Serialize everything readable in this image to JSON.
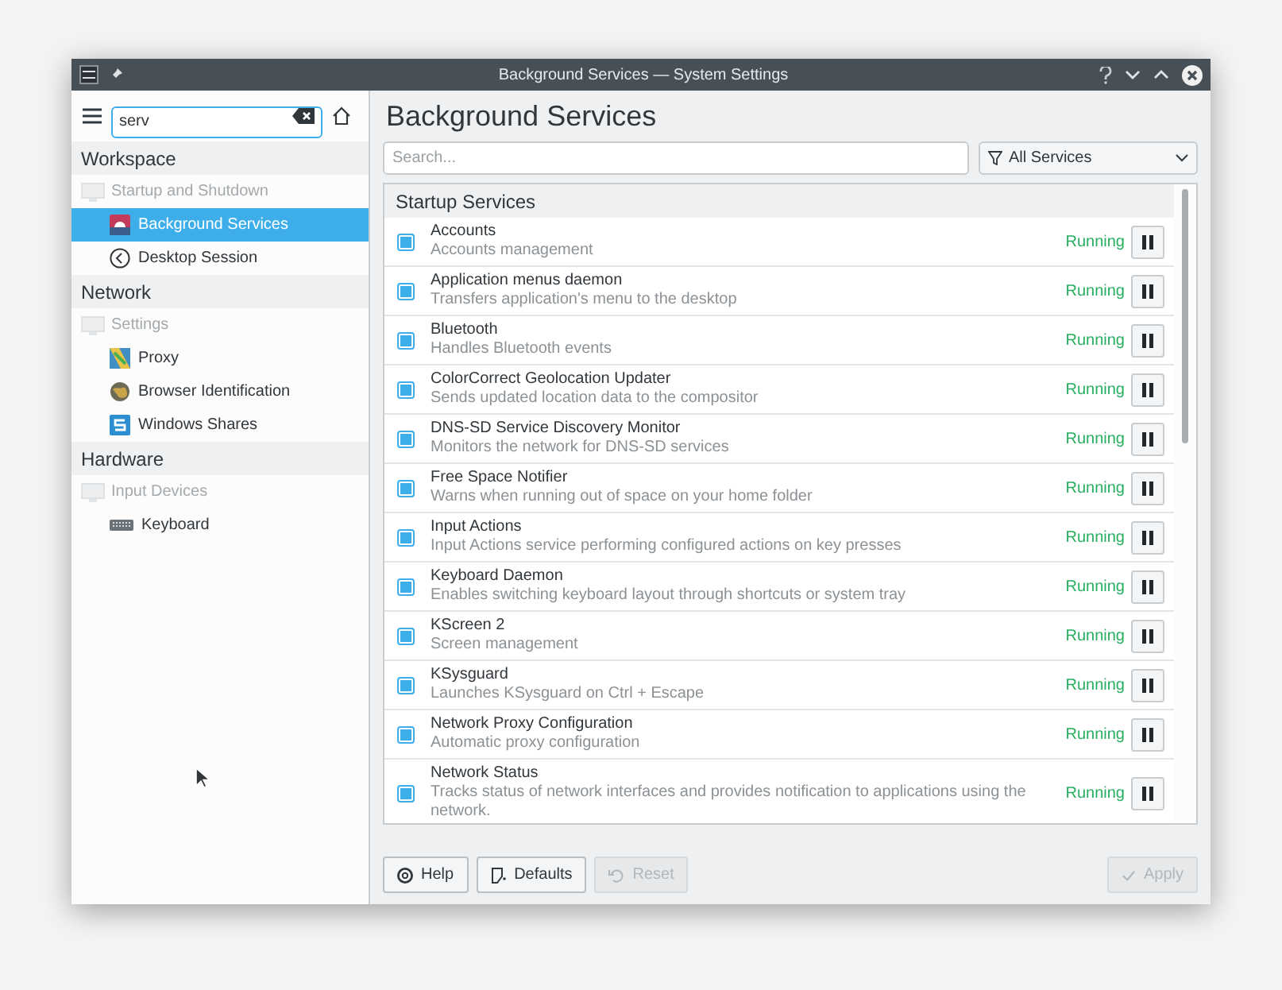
{
  "window": {
    "title": "Background Services — System Settings"
  },
  "sidebar": {
    "search": {
      "value": "serv"
    },
    "groups": [
      {
        "title": "Workspace",
        "items": [
          {
            "label": "Startup and Shutdown",
            "disabled": true,
            "children": [
              {
                "label": "Background Services",
                "selected": true
              },
              {
                "label": "Desktop Session",
                "selected": false
              }
            ]
          }
        ]
      },
      {
        "title": "Network",
        "items": [
          {
            "label": "Settings",
            "disabled": true,
            "children": [
              {
                "label": "Proxy",
                "selected": false
              },
              {
                "label": "Browser Identification",
                "selected": false
              },
              {
                "label": "Windows Shares",
                "selected": false
              }
            ]
          }
        ]
      },
      {
        "title": "Hardware",
        "items": [
          {
            "label": "Input Devices",
            "disabled": true,
            "children": [
              {
                "label": "Keyboard",
                "selected": false
              }
            ]
          }
        ]
      }
    ]
  },
  "page": {
    "title": "Background Services",
    "search": {
      "placeholder": "Search..."
    },
    "filter": {
      "value": "All Services"
    },
    "section": "Startup Services",
    "services": [
      {
        "name": "Accounts",
        "description": "Accounts management",
        "checked": true,
        "status": "Running"
      },
      {
        "name": "Application menus daemon",
        "description": "Transfers application's menu to the desktop",
        "checked": true,
        "status": "Running"
      },
      {
        "name": "Bluetooth",
        "description": "Handles Bluetooth events",
        "checked": true,
        "status": "Running"
      },
      {
        "name": "ColorCorrect Geolocation Updater",
        "description": "Sends updated location data to the compositor",
        "checked": true,
        "status": "Running"
      },
      {
        "name": "DNS-SD Service Discovery Monitor",
        "description": "Monitors the network for DNS-SD services",
        "checked": true,
        "status": "Running"
      },
      {
        "name": "Free Space Notifier",
        "description": "Warns when running out of space on your home folder",
        "checked": true,
        "status": "Running"
      },
      {
        "name": "Input Actions",
        "description": "Input Actions service performing configured actions on key presses",
        "checked": true,
        "status": "Running"
      },
      {
        "name": "Keyboard Daemon",
        "description": "Enables switching keyboard layout through shortcuts or system tray",
        "checked": true,
        "status": "Running"
      },
      {
        "name": "KScreen 2",
        "description": "Screen management",
        "checked": true,
        "status": "Running"
      },
      {
        "name": "KSysguard",
        "description": "Launches KSysguard on Ctrl + Escape",
        "checked": true,
        "status": "Running"
      },
      {
        "name": "Network Proxy Configuration",
        "description": "Automatic proxy configuration",
        "checked": true,
        "status": "Running"
      },
      {
        "name": "Network Status",
        "description": "Tracks status of network interfaces and provides notification to applications using the network.",
        "checked": true,
        "status": "Running"
      }
    ]
  },
  "buttons": [
    {
      "label": "Help",
      "disabled": false
    },
    {
      "label": "Defaults",
      "disabled": false
    },
    {
      "label": "Reset",
      "disabled": true
    },
    {
      "label": "Apply",
      "disabled": true
    }
  ]
}
